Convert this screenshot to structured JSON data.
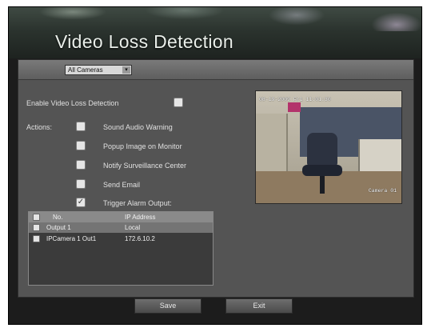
{
  "header": {
    "title": "Video Loss Detection"
  },
  "camera_selector": {
    "value": "All Cameras",
    "arrow": "▾"
  },
  "enable": {
    "label": "Enable Video Loss Detection",
    "checked": false
  },
  "actions": {
    "label": "Actions:",
    "items": [
      {
        "label": "Sound Audio Warning",
        "checked": false
      },
      {
        "label": "Popup Image on Monitor",
        "checked": false
      },
      {
        "label": "Notify Surveillance Center",
        "checked": false
      },
      {
        "label": "Send Email",
        "checked": false
      },
      {
        "label": "Trigger Alarm Output:",
        "checked": true,
        "mark": "✓"
      }
    ]
  },
  "alarm_table": {
    "columns": [
      "No.",
      "IP Address"
    ],
    "rows": [
      {
        "no": "Output 1",
        "ip": "Local"
      },
      {
        "no": "IPCamera 1 Out1",
        "ip": "172.6.10.2"
      }
    ]
  },
  "preview": {
    "timestamp": "08-19-2009 Fri 11:01:30",
    "camera_name": "Camera 01"
  },
  "buttons": {
    "save": "Save",
    "exit": "Exit"
  }
}
